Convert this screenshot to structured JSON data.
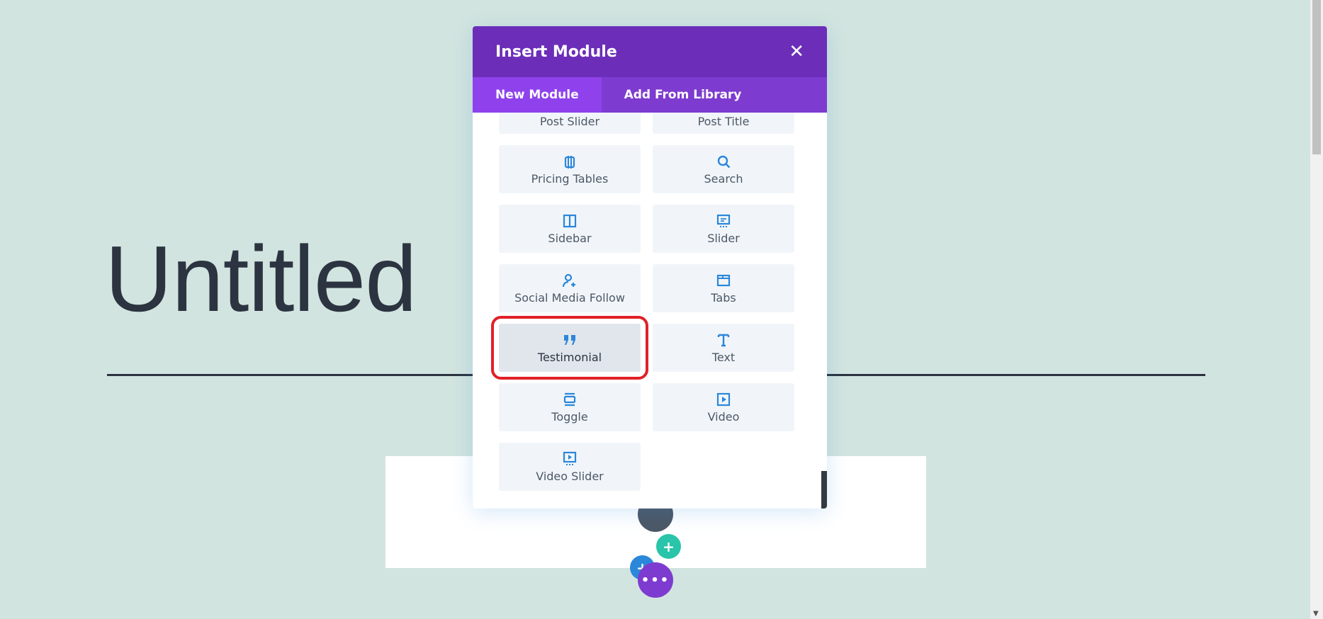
{
  "page": {
    "title": "Untitled"
  },
  "modal": {
    "title": "Insert Module",
    "close_icon": "close-icon",
    "tabs": [
      {
        "label": "New Module",
        "active": true
      },
      {
        "label": "Add From Library",
        "active": false
      }
    ],
    "modules": [
      {
        "label": "Post Slider",
        "icon": "none"
      },
      {
        "label": "Post Title",
        "icon": "none"
      },
      {
        "label": "Pricing Tables",
        "icon": "pricing-tables-icon"
      },
      {
        "label": "Search",
        "icon": "search-icon"
      },
      {
        "label": "Sidebar",
        "icon": "sidebar-icon"
      },
      {
        "label": "Slider",
        "icon": "slider-icon"
      },
      {
        "label": "Social Media Follow",
        "icon": "social-follow-icon"
      },
      {
        "label": "Tabs",
        "icon": "tabs-icon"
      },
      {
        "label": "Testimonial",
        "icon": "quote-icon",
        "highlighted": true
      },
      {
        "label": "Text",
        "icon": "text-icon"
      },
      {
        "label": "Toggle",
        "icon": "toggle-icon"
      },
      {
        "label": "Video",
        "icon": "video-icon"
      },
      {
        "label": "Video Slider",
        "icon": "video-slider-icon"
      }
    ]
  },
  "colors": {
    "header": "#6c2eb9",
    "tabs": "#7e3bd0",
    "active_tab": "#8f42ec",
    "icon": "#2b87da",
    "highlight": "#e02027",
    "background": "#d2e4df"
  }
}
